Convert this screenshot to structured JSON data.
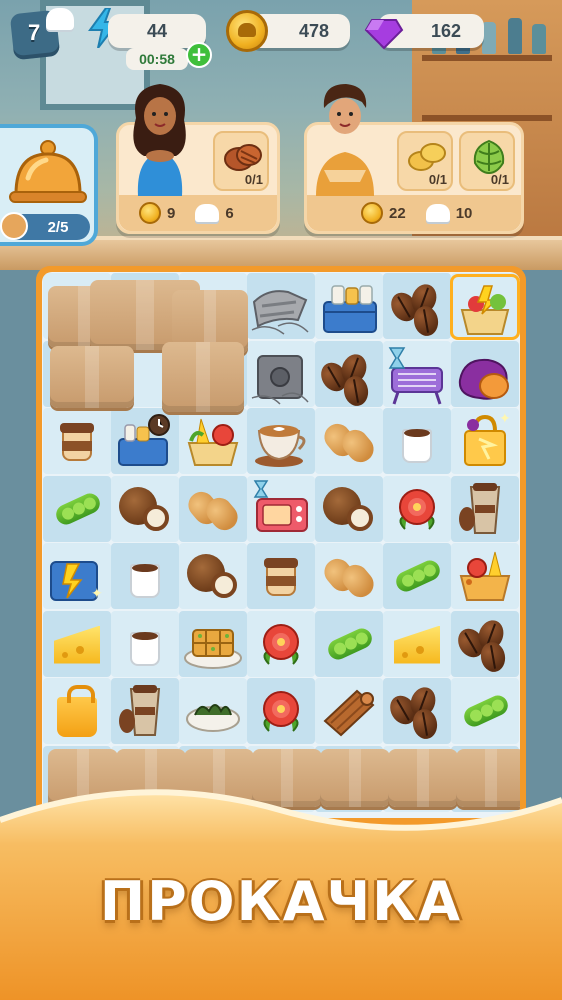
{
  "hud": {
    "level": "7",
    "energy": "44",
    "energy_timer": "00:58",
    "plus": "+",
    "coins": "478",
    "gems": "162"
  },
  "bell_station": {
    "progress": "2/5"
  },
  "orders": [
    {
      "customer": "woman",
      "items": [
        {
          "food": "cookies",
          "progress": "0/1"
        }
      ],
      "reward_coins": "9",
      "reward_xp": "6"
    },
    {
      "customer": "man",
      "items": [
        {
          "food": "potatoes",
          "progress": "0/1"
        },
        {
          "food": "artichoke",
          "progress": "0/1"
        }
      ],
      "reward_coins": "22",
      "reward_xp": "10"
    }
  ],
  "board": {
    "rows": [
      [
        "box",
        "box",
        "box",
        "dusty-scarf",
        "milk-crate",
        "coffee-beans",
        "food-basket-generator"
      ],
      [
        "box",
        "box",
        "box",
        "dusty-safe",
        "coffee-beans",
        "grill-timer",
        "sweet-potato"
      ],
      [
        "takeaway-coffee",
        "picnic-basket-generator",
        "veggie-basket",
        "latte-art-cup",
        "peanuts",
        "coffee-cup",
        "golden-bag"
      ],
      [
        "peas",
        "coconut",
        "peanuts",
        "toaster-oven",
        "coconut",
        "red-flower",
        "iced-coffee"
      ],
      [
        "blue-crate",
        "coffee-cup",
        "coconut",
        "takeaway-coffee",
        "peanuts",
        "peas",
        "gift-basket"
      ],
      [
        "cheese",
        "coffee-cup",
        "baklava",
        "red-flower",
        "peas",
        "cheese",
        "coffee-beans"
      ],
      [
        "shopping-bag",
        "iced-coffee",
        "seaweed-bowl",
        "red-flower",
        "cinnamon-roll",
        "coffee-beans",
        "peas"
      ],
      [
        "box",
        "box",
        "box",
        "box",
        "box",
        "box",
        "box"
      ]
    ]
  },
  "banner": {
    "title": "ПРОКАЧКА"
  },
  "colors": {
    "board_frame": "#f39a2a",
    "banner_top": "#f6b55a",
    "banner_bottom": "#e98a1d",
    "plus_button": "#3fbf3b"
  }
}
